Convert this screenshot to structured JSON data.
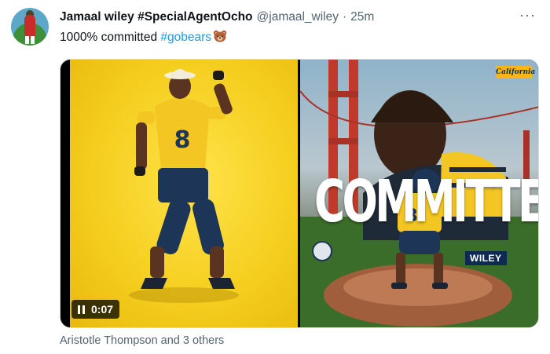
{
  "tweet": {
    "display_name": "Jamaal wiley #SpecialAgentOcho",
    "handle": "@jamaal_wiley",
    "separator": "·",
    "time": "25m",
    "text_prefix": "1000% committed ",
    "hashtag": "#gobears",
    "more_icon": "···"
  },
  "media": {
    "video_time": "0:07",
    "graphic_headline": "COMMITTED",
    "graphic_name_tag": "WILEY",
    "logo_text": "California"
  },
  "liked_by": "Aristotle Thompson and 3 others",
  "icons": {
    "bear": "bear-face-emoji",
    "pause": "pause-icon",
    "more": "more-options-icon"
  },
  "colors": {
    "hashtag_blue": "#1d9bf0",
    "meta_gray": "#536471",
    "cal_gold": "#fdb515",
    "cal_navy": "#003262"
  }
}
